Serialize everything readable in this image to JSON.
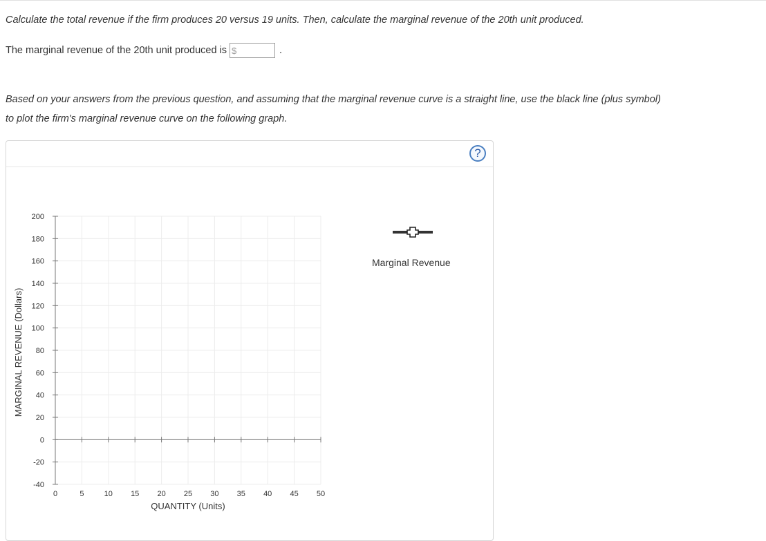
{
  "question": {
    "line1": "Calculate the total revenue if the firm produces 20 versus 19 units. Then, calculate the marginal revenue of the 20th unit produced.",
    "mr_prefix": "The marginal revenue of the 20th unit produced is",
    "currency_symbol": "$",
    "mr_value": "",
    "period": ".",
    "instruction_line1": "Based on your answers from the previous question, and assuming that the marginal revenue curve is a straight line, use the black line (plus symbol)",
    "instruction_line2": "to plot the firm's marginal revenue curve on the following graph."
  },
  "graph_panel": {
    "help_label": "?",
    "help_icon": "question-circle-icon",
    "accent_color": "#4a7fc1"
  },
  "legend": {
    "tool_icon": "plus-line-tool-icon",
    "label": "Marginal Revenue",
    "line_color": "#333333"
  },
  "chart_data": {
    "type": "line",
    "xlabel": "QUANTITY (Units)",
    "ylabel": "MARGINAL REVENUE (Dollars)",
    "xlim": [
      0,
      50
    ],
    "ylim": [
      -40,
      200
    ],
    "x_ticks": [
      0,
      5,
      10,
      15,
      20,
      25,
      30,
      35,
      40,
      45,
      50
    ],
    "y_ticks": [
      200,
      180,
      160,
      140,
      120,
      100,
      80,
      60,
      40,
      20,
      0,
      -20,
      -40
    ],
    "grid": true,
    "series": []
  }
}
